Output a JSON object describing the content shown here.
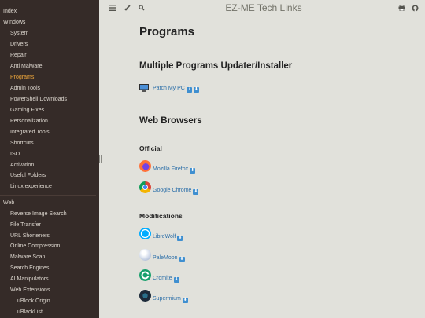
{
  "sidebar": {
    "items": [
      {
        "label": "Index",
        "level": 0,
        "active": false
      },
      {
        "label": "Windows",
        "level": 0,
        "active": false
      },
      {
        "label": "System",
        "level": 1,
        "active": false
      },
      {
        "label": "Drivers",
        "level": 1,
        "active": false
      },
      {
        "label": "Repair",
        "level": 1,
        "active": false
      },
      {
        "label": "Anti Malware",
        "level": 1,
        "active": false
      },
      {
        "label": "Programs",
        "level": 1,
        "active": true
      },
      {
        "label": "Admin Tools",
        "level": 1,
        "active": false
      },
      {
        "label": "PowerShell Downloads",
        "level": 1,
        "active": false
      },
      {
        "label": "Gaming Fixes",
        "level": 1,
        "active": false
      },
      {
        "label": "Personalization",
        "level": 1,
        "active": false
      },
      {
        "label": "Integrated Tools",
        "level": 1,
        "active": false
      },
      {
        "label": "Shortcuts",
        "level": 1,
        "active": false
      },
      {
        "label": "ISO",
        "level": 1,
        "active": false
      },
      {
        "label": "Activation",
        "level": 1,
        "active": false
      },
      {
        "label": "Useful Folders",
        "level": 1,
        "active": false
      },
      {
        "label": "Linux experience",
        "level": 1,
        "active": false
      },
      {
        "label": "Web",
        "level": 0,
        "active": false
      },
      {
        "label": "Reverse Image Search",
        "level": 1,
        "active": false
      },
      {
        "label": "File Transfer",
        "level": 1,
        "active": false
      },
      {
        "label": "URL Shorteners",
        "level": 1,
        "active": false
      },
      {
        "label": "Online Compression",
        "level": 1,
        "active": false
      },
      {
        "label": "Malware Scan",
        "level": 1,
        "active": false
      },
      {
        "label": "Search Engines",
        "level": 1,
        "active": false
      },
      {
        "label": "AI Manipulators",
        "level": 1,
        "active": false
      },
      {
        "label": "Web Extensions",
        "level": 1,
        "active": false
      },
      {
        "label": "uBlock Origin",
        "level": 2,
        "active": false
      },
      {
        "label": "uBlackList",
        "level": 2,
        "active": false
      }
    ]
  },
  "topbar": {
    "title": "EZ-ME Tech Links",
    "icons": [
      "menu-icon",
      "brush-icon",
      "search-icon",
      "print-icon",
      "github-icon"
    ]
  },
  "content": {
    "page_title": "Programs",
    "sections": {
      "updater": {
        "heading": "Multiple Programs Updater/Installer",
        "programs": [
          {
            "name": "Patch My PC",
            "icon": "patch-my-pc-icon",
            "buttons": [
              "info",
              "download"
            ]
          }
        ]
      },
      "browsers": {
        "heading": "Web Browsers",
        "official": {
          "heading": "Official",
          "programs": [
            {
              "name": "Mozilla Firefox",
              "icon": "firefox-icon",
              "buttons": [
                "download"
              ]
            },
            {
              "name": "Google Chrome",
              "icon": "chrome-icon",
              "buttons": [
                "download"
              ]
            }
          ]
        },
        "modifications": {
          "heading": "Modifications",
          "programs": [
            {
              "name": "LibreWolf",
              "icon": "librewolf-icon",
              "buttons": [
                "download"
              ]
            },
            {
              "name": "PaleMoon",
              "icon": "palemoon-icon",
              "buttons": [
                "download"
              ]
            },
            {
              "name": "Cromite",
              "icon": "cromite-icon",
              "buttons": [
                "download"
              ]
            },
            {
              "name": "Supermium",
              "icon": "supermium-icon",
              "buttons": [
                "download"
              ]
            }
          ]
        }
      }
    }
  },
  "colors": {
    "sidebar_bg": "#352b28",
    "sidebar_text": "#ddd7cf",
    "sidebar_active": "#f0a83c",
    "page_bg": "#e1e1db",
    "link": "#2b6ea8",
    "download_button": "#3f8fd0"
  }
}
